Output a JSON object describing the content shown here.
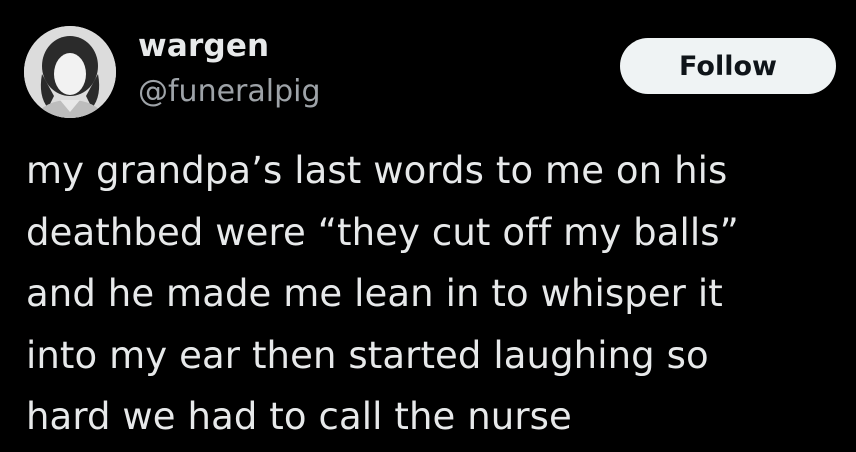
{
  "user": {
    "display_name": "wargen",
    "handle": "@funeralpig"
  },
  "follow_button": {
    "label": "Follow"
  },
  "tweet": {
    "lines": [
      "my grandpa’s last words to me on his",
      "deathbed were “they cut off my balls”",
      "and he made me lean in to whisper it",
      "into my ear then started laughing so",
      "hard we had to call the nurse"
    ]
  },
  "colors": {
    "background": "#000000",
    "text_primary": "#e7e9ea",
    "text_secondary": "#9ea3a8",
    "button_bg": "#eff3f4",
    "button_text": "#0f1419"
  }
}
